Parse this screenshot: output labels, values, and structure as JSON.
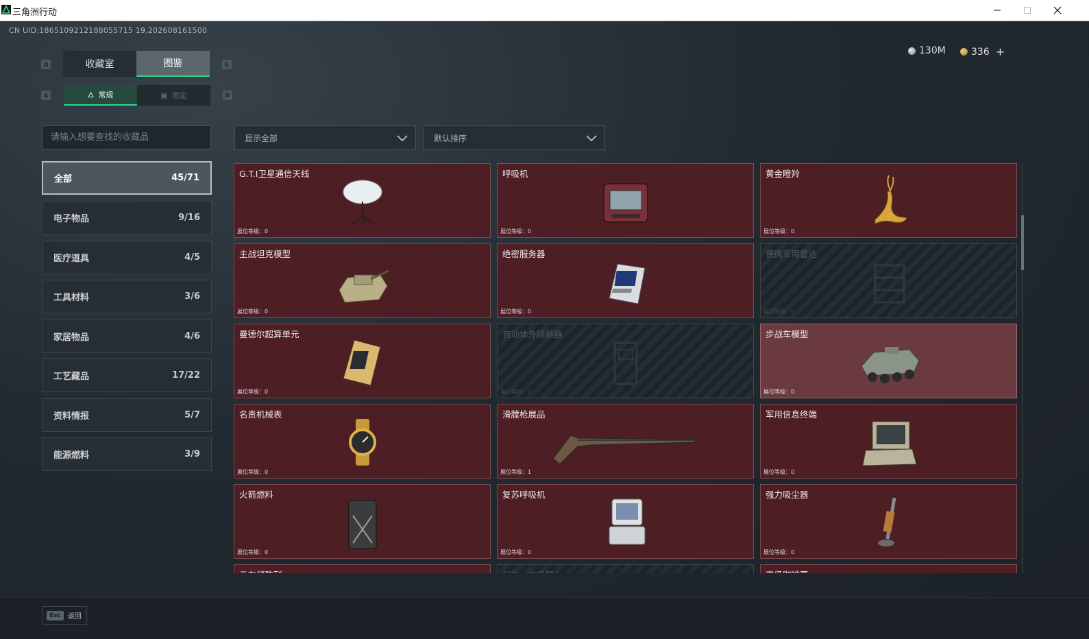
{
  "window": {
    "title": "三角洲行动",
    "icon": "delta-force-logo-icon"
  },
  "header": {
    "uid": "CN UID:1865109212188055715 19,202608161500",
    "tabs": [
      {
        "label": "收藏室",
        "active": false
      },
      {
        "label": "图鉴",
        "active": true
      }
    ],
    "tab_hotkeys": [
      "Q",
      "E"
    ],
    "subtabs": [
      {
        "label": "常规",
        "icon": "flame-icon",
        "active": true
      },
      {
        "label": "限定",
        "icon": "image-icon",
        "active": false
      }
    ],
    "subtab_hotkeys": [
      "A",
      "D"
    ],
    "currency": [
      {
        "value": "130M",
        "icon": "silver-coin-icon"
      },
      {
        "value": "336",
        "icon": "gold-coin-icon"
      }
    ],
    "add_label": "+"
  },
  "search": {
    "placeholder": "请输入想要查找的收藏品"
  },
  "filters": {
    "display": "显示全部",
    "sort": "默认排序"
  },
  "categories": [
    {
      "label": "全部",
      "count": "45/71",
      "active": true
    },
    {
      "label": "电子物品",
      "count": "9/16"
    },
    {
      "label": "医疗道具",
      "count": "4/5"
    },
    {
      "label": "工具材料",
      "count": "3/6"
    },
    {
      "label": "家居物品",
      "count": "4/6"
    },
    {
      "label": "工艺藏品",
      "count": "17/22"
    },
    {
      "label": "资料情报",
      "count": "5/7"
    },
    {
      "label": "能源燃料",
      "count": "3/9"
    }
  ],
  "items": [
    {
      "name": "G.T.I卫星通信天线",
      "level": "展位等级：0",
      "locked": false,
      "art": "satellite-dish-icon"
    },
    {
      "name": "呼吸机",
      "level": "展位等级：0",
      "locked": false,
      "art": "ventilator-icon"
    },
    {
      "name": "黄金瞪羚",
      "level": "展位等级：0",
      "locked": false,
      "art": "golden-gazelle-icon"
    },
    {
      "name": "主战坦克模型",
      "level": "展位等级：0",
      "locked": false,
      "art": "tank-model-icon"
    },
    {
      "name": "绝密服务器",
      "level": "展位等级：0",
      "locked": false,
      "art": "server-icon"
    },
    {
      "name": "便携军用雷达",
      "level": "展位等级：0",
      "locked": true,
      "art": "radar-icon"
    },
    {
      "name": "曼德尔超算单元",
      "level": "展位等级：0",
      "locked": false,
      "art": "compute-unit-icon"
    },
    {
      "name": "自动体外除颤器",
      "level": "展位等级：0",
      "locked": true,
      "art": "defibrillator-icon"
    },
    {
      "name": "步战车模型",
      "level": "展位等级：0",
      "locked": false,
      "highlight": true,
      "art": "ifv-model-icon"
    },
    {
      "name": "名贵机械表",
      "level": "展位等级：0",
      "locked": false,
      "art": "wristwatch-icon"
    },
    {
      "name": "滑膛枪展品",
      "level": "展位等级：1",
      "locked": false,
      "art": "musket-icon"
    },
    {
      "name": "军用信息终端",
      "level": "展位等级：0",
      "locked": false,
      "art": "field-terminal-icon"
    },
    {
      "name": "火箭燃料",
      "level": "展位等级：0",
      "locked": false,
      "art": "fuel-can-icon"
    },
    {
      "name": "复苏呼吸机",
      "level": "展位等级：0",
      "locked": false,
      "art": "resuscitator-icon"
    },
    {
      "name": "强力吸尘器",
      "level": "展位等级：0",
      "locked": false,
      "art": "vacuum-icon"
    },
    {
      "name": "云存储阵列",
      "level": "",
      "locked": false,
      "art": ""
    },
    {
      "name": "扫拖一体机器人",
      "level": "",
      "locked": true,
      "art": ""
    },
    {
      "name": "高级咖啡豆",
      "level": "",
      "locked": false,
      "art": ""
    }
  ],
  "footer": {
    "key": "Esc",
    "label": "返回"
  }
}
